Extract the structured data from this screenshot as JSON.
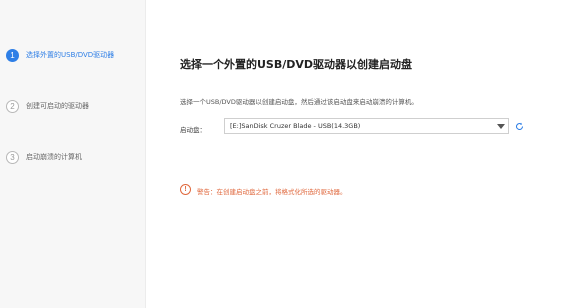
{
  "steps": [
    {
      "number": "1",
      "label": "选择外置的USB/DVD驱动器"
    },
    {
      "number": "2",
      "label": "创建可启动的驱动器"
    },
    {
      "number": "3",
      "label": "启动崩溃的计算机"
    }
  ],
  "main": {
    "title": "选择一个外置的USB/DVD驱动器以创建启动盘",
    "description": "选择一个USB/DVD驱动器以创建启动盘，然后通过该启动盘来启动崩溃的计算机。",
    "drive_label": "启动盘：",
    "drive_value": "[E:]SanDisk Cruzer Blade - USB(14.3GB)",
    "warning_icon": "!",
    "warning_text": "警告：在创建启动盘之前，将格式化所选的驱动器。"
  },
  "icons": {
    "dropdown": "chevron-down-icon",
    "refresh": "refresh-icon",
    "warning": "warning-icon"
  },
  "colors": {
    "accent": "#2f7fe6",
    "warning": "#e0683d"
  }
}
